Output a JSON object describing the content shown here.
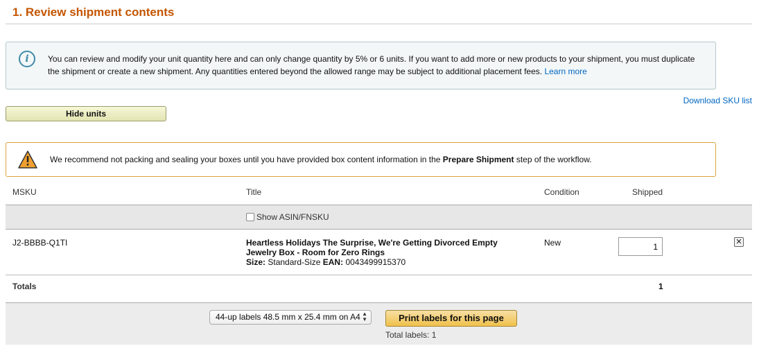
{
  "section": {
    "title": "1. Review shipment contents"
  },
  "info": {
    "text": "You can review and modify your unit quantity here and can only change quantity by 5% or 6 units. If you want to add more or new products to your shipment, you must duplicate the shipment or create a new shipment. Any quantities entered beyond the allowed range may be subject to additional placement fees.",
    "link": "Learn more"
  },
  "actions": {
    "hide_units": "Hide units",
    "download_sku": "Download SKU list"
  },
  "warning": {
    "text_before": "We recommend not packing and sealing your boxes until you have provided box content information in the",
    "text_bold": "Prepare Shipment",
    "text_after": "step of the workflow."
  },
  "table": {
    "headers": {
      "msku": "MSKU",
      "title": "Title",
      "condition": "Condition",
      "shipped": "Shipped"
    },
    "show_asin_label": "Show ASIN/FNSKU",
    "rows": [
      {
        "msku": "J2-BBBB-Q1TI",
        "title_line1": "Heartless Holidays The Surprise, We're Getting Divorced Empty",
        "title_line2": "Jewelry Box - Room for Zero Rings",
        "size_label": "Size:",
        "size_value": "Standard-Size",
        "ean_label": "EAN:",
        "ean_value": "0043499915370",
        "condition": "New",
        "shipped": "1"
      }
    ],
    "totals_label": "Totals",
    "totals_value": "1"
  },
  "footer": {
    "label_format": "44-up labels 48.5 mm x 25.4 mm on A4",
    "print_button": "Print labels for this page",
    "total_labels": "Total labels: 1"
  },
  "colors": {
    "title": "#c45500",
    "link": "#0066c0",
    "info_icon": "#3f8aa6",
    "warning_border": "#d9a53b"
  }
}
